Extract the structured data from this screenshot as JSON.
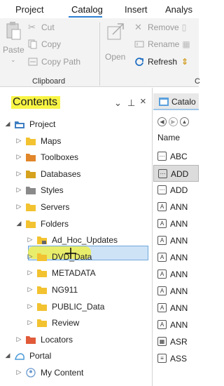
{
  "ribbon": {
    "tabs": [
      {
        "label": "Project",
        "active": false
      },
      {
        "label": "Catalog",
        "active": true
      },
      {
        "label": "Insert",
        "active": false
      },
      {
        "label": "Analys",
        "active": false
      }
    ],
    "clipboard": {
      "paste": "Paste",
      "cut": "Cut",
      "copy": "Copy",
      "copy_path": "Copy Path",
      "group_label": "Clipboard"
    },
    "organize": {
      "open": "Open",
      "remove": "Remove",
      "rename": "Rename",
      "refresh": "Refresh",
      "group_label": "C"
    }
  },
  "contents_pane": {
    "title": "Contents",
    "controls": {
      "menu": "⌄",
      "pin": "⊥",
      "close": "×"
    },
    "tree": [
      {
        "label": "Project",
        "indent": 0,
        "expanded": true,
        "icon": "project-icon"
      },
      {
        "label": "Maps",
        "indent": 1,
        "expanded": false,
        "icon": "maps-folder-icon"
      },
      {
        "label": "Toolboxes",
        "indent": 1,
        "expanded": false,
        "icon": "toolboxes-folder-icon"
      },
      {
        "label": "Databases",
        "indent": 1,
        "expanded": false,
        "icon": "databases-folder-icon"
      },
      {
        "label": "Styles",
        "indent": 1,
        "expanded": false,
        "icon": "styles-folder-icon"
      },
      {
        "label": "Servers",
        "indent": 1,
        "expanded": false,
        "icon": "servers-folder-icon"
      },
      {
        "label": "Folders",
        "indent": 1,
        "expanded": true,
        "icon": "folders-icon",
        "selected": true
      },
      {
        "label": "Ad_Hoc_Updates",
        "indent": 2,
        "expanded": false,
        "icon": "folder-lock-icon"
      },
      {
        "label": "DVD_Data",
        "indent": 2,
        "expanded": false,
        "icon": "folder-icon"
      },
      {
        "label": "METADATA",
        "indent": 2,
        "expanded": false,
        "icon": "folder-icon"
      },
      {
        "label": "NG911",
        "indent": 2,
        "expanded": false,
        "icon": "folder-icon"
      },
      {
        "label": "PUBLIC_Data",
        "indent": 2,
        "expanded": false,
        "icon": "folder-icon"
      },
      {
        "label": "Review",
        "indent": 2,
        "expanded": false,
        "icon": "folder-icon"
      },
      {
        "label": "Locators",
        "indent": 1,
        "expanded": false,
        "icon": "locators-folder-icon"
      },
      {
        "label": "Portal",
        "indent": 0,
        "expanded": true,
        "icon": "portal-icon"
      },
      {
        "label": "My Content",
        "indent": 1,
        "expanded": false,
        "icon": "my-content-icon"
      }
    ]
  },
  "catalog_pane": {
    "tab_label": "Catalo",
    "column_header": "Name",
    "items": [
      {
        "label": "ABC",
        "icon": "table-icon",
        "selected": false
      },
      {
        "label": "ADD",
        "icon": "table-icon",
        "selected": true
      },
      {
        "label": "ADD",
        "icon": "table-icon",
        "selected": false
      },
      {
        "label": "ANN",
        "icon": "annotation-icon",
        "selected": false
      },
      {
        "label": "ANN",
        "icon": "annotation-icon",
        "selected": false
      },
      {
        "label": "ANN",
        "icon": "annotation-icon",
        "selected": false
      },
      {
        "label": "ANN",
        "icon": "annotation-icon",
        "selected": false
      },
      {
        "label": "ANN",
        "icon": "annotation-icon",
        "selected": false
      },
      {
        "label": "ANN",
        "icon": "annotation-icon",
        "selected": false
      },
      {
        "label": "ANN",
        "icon": "annotation-icon",
        "selected": false
      },
      {
        "label": "ANN",
        "icon": "annotation-icon",
        "selected": false
      },
      {
        "label": "ASR",
        "icon": "raster-icon",
        "selected": false
      },
      {
        "label": "ASS",
        "icon": "table-grid-icon",
        "selected": false
      }
    ]
  },
  "colors": {
    "accent": "#2a7fd4",
    "folder_yellow": "#f2c230",
    "highlight_yellow": "#f8f545",
    "selection": "#cfe3f7"
  }
}
